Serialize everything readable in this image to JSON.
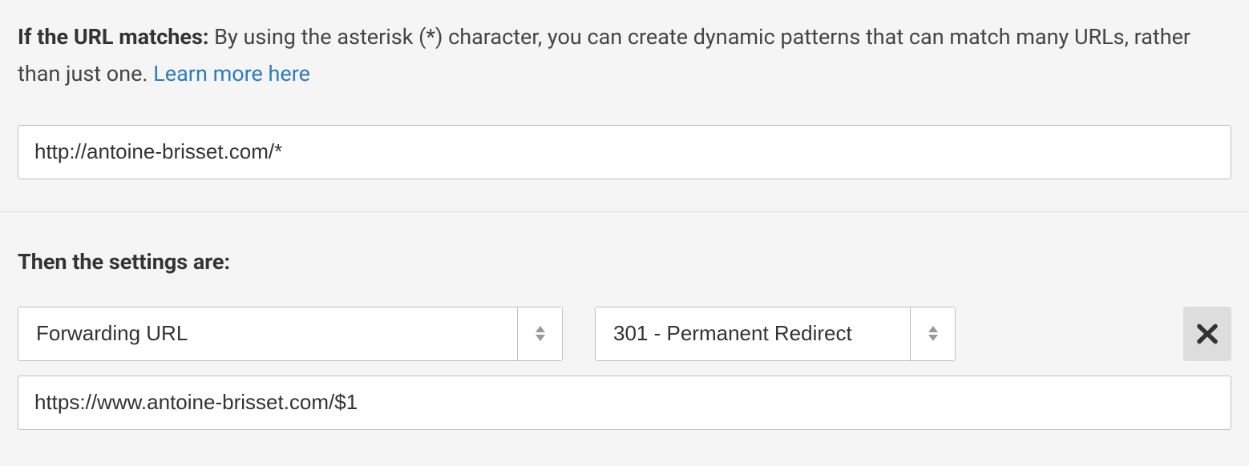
{
  "section1": {
    "label": "If the URL matches:",
    "description": " By using the asterisk (*) character, you can create dynamic patterns that can match many URLs, rather than just one. ",
    "learn_more": "Learn more here",
    "url_value": "http://antoine-brisset.com/*"
  },
  "section2": {
    "heading": "Then the settings are:",
    "setting_type": "Forwarding URL",
    "redirect_type": "301 - Permanent Redirect",
    "destination_value": "https://www.antoine-brisset.com/$1"
  }
}
